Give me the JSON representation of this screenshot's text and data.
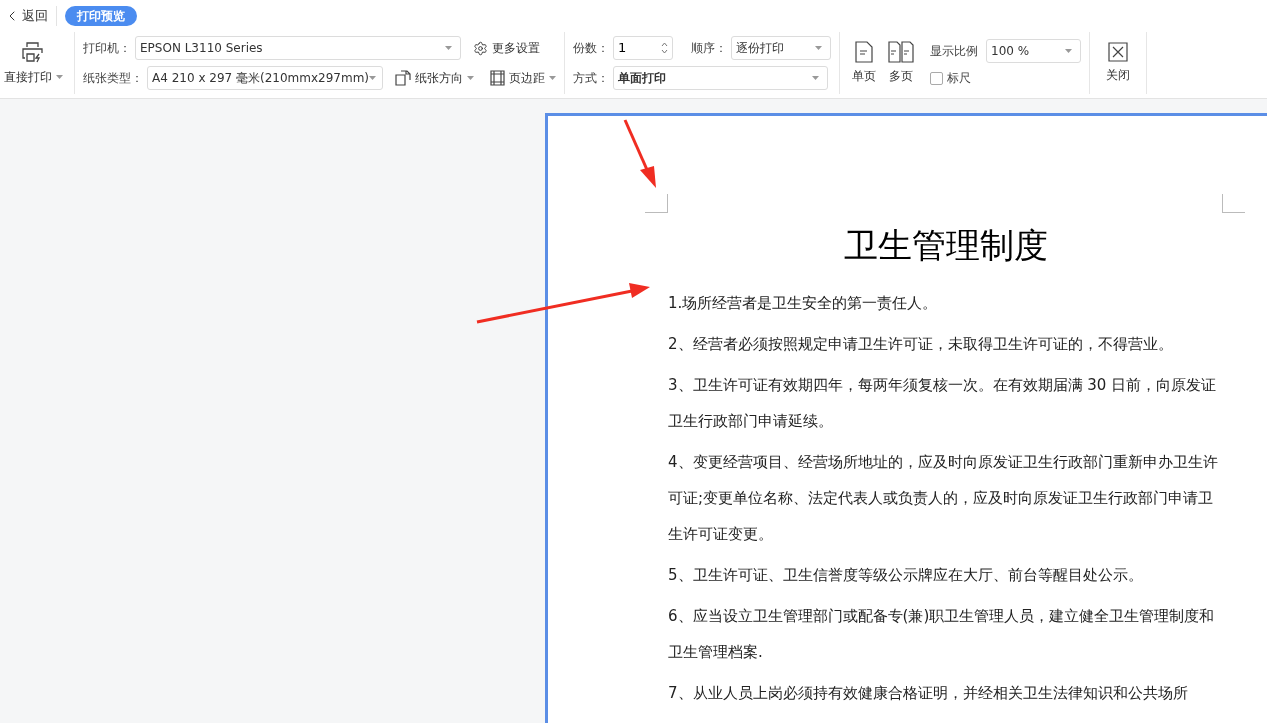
{
  "nav": {
    "back": "返回",
    "tabs": [
      {
        "label": "打印预览",
        "selected": true
      }
    ]
  },
  "toolbar": {
    "direct_print": "直接打印",
    "printer": {
      "label": "打印机：",
      "value": "EPSON L3110 Series"
    },
    "more_settings": "更多设置",
    "paper": {
      "label": "纸张类型：",
      "value": "A4 210 x 297 毫米(210mmx297mm)"
    },
    "orientation": "纸张方向",
    "margins": "页边距",
    "copies": {
      "label": "份数：",
      "value": "1"
    },
    "order": {
      "label": "顺序：",
      "value": "逐份打印"
    },
    "mode": {
      "label": "方式：",
      "value": "单面打印"
    },
    "single_page": "单页",
    "multi_page": "多页",
    "zoom": {
      "label": "显示比例",
      "value": "100 %"
    },
    "ruler": {
      "label": "标尺",
      "checked": false
    },
    "close": "关闭"
  },
  "document": {
    "title": "卫生管理制度",
    "paragraphs": [
      "1.场所经营者是卫生安全的第一责任人。",
      "2、经营者必须按照规定申请卫生许可证，未取得卫生许可证的，不得营业。",
      "3、卫生许可证有效期四年，每两年须复核一次。在有效期届满 30 日前，向原发证卫生行政部门申请延续。",
      "4、变更经营项目、经营场所地址的，应及时向原发证卫生行政部门重新申办卫生许可证;变更单位名称、法定代表人或负责人的，应及时向原发证卫生行政部门申请卫生许可证变更。",
      "5、卫生许可证、卫生信誉度等级公示牌应在大厅、前台等醒目处公示。",
      "6、应当设立卫生管理部门或配备专(兼)职卫生管理人员，建立健全卫生管理制度和卫生管理档案.",
      "7、从业人员上岗必须持有效健康合格证明，并经相关卫生法律知识和公共场所"
    ]
  }
}
